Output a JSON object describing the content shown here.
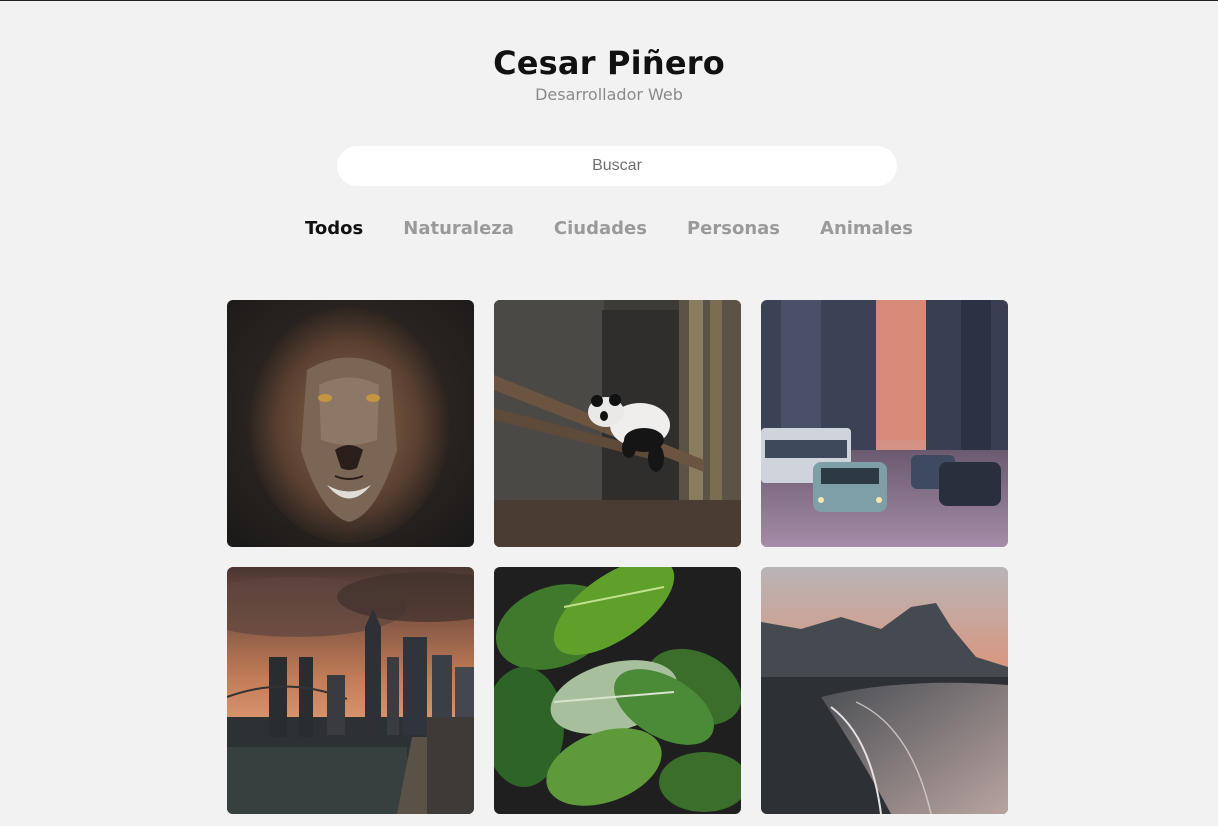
{
  "header": {
    "name": "Cesar Piñero",
    "role": "Desarrollador Web"
  },
  "search": {
    "placeholder": "Buscar",
    "value": ""
  },
  "filters": [
    {
      "label": "Todos",
      "active": true
    },
    {
      "label": "Naturaleza",
      "active": false
    },
    {
      "label": "Ciudades",
      "active": false
    },
    {
      "label": "Personas",
      "active": false
    },
    {
      "label": "Animales",
      "active": false
    }
  ],
  "gallery": [
    {
      "subject": "lion"
    },
    {
      "subject": "panda"
    },
    {
      "subject": "city-street"
    },
    {
      "subject": "city-skyline"
    },
    {
      "subject": "leaves"
    },
    {
      "subject": "mountain-coast"
    }
  ],
  "colors": {
    "background": "#f2f2f2",
    "active_tab": "#111111",
    "inactive_tab": "#9a9a9a",
    "subtitle": "#8a8a8a"
  }
}
